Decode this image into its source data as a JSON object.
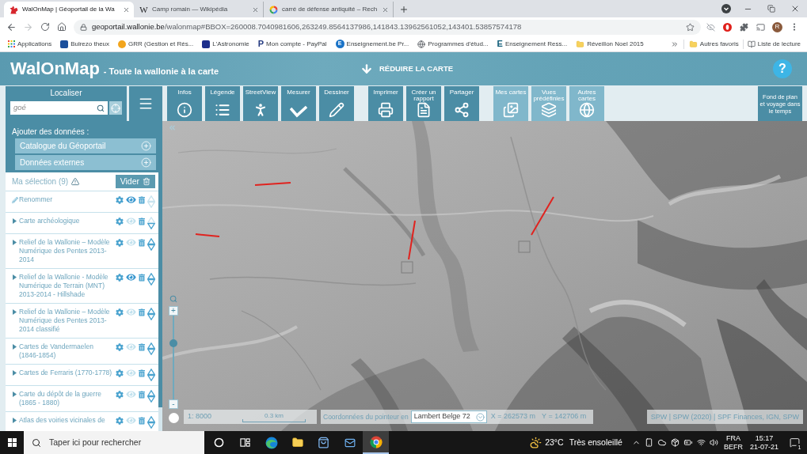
{
  "browser": {
    "tabs": [
      {
        "title": "WalOnMap | Géoportail de la Wa",
        "kind": "rooster",
        "selected": true
      },
      {
        "title": "Camp romain — Wikipédia",
        "kind": "letter",
        "icon_text": "W",
        "selected": false
      },
      {
        "title": "carré de défense antiquité – Rech",
        "kind": "ring",
        "selected": false
      }
    ],
    "address": {
      "host": "geoportail.wallonie.be",
      "path": "/walonmap#BBOX=260008.7040981606,263249.8564137986,141843.13962561052,143401.53857574178",
      "can_go_forward": false
    },
    "profile_initial": "R",
    "bookmarks": [
      {
        "label": "Applications",
        "kind": "apps"
      },
      {
        "label": "Bulrezo theux",
        "kind": "tile",
        "color": "#1b4f9c"
      },
      {
        "label": "GRR (Gestion et Rés...",
        "kind": "disc",
        "color": "#f2a51d"
      },
      {
        "label": "L'Astronomie",
        "kind": "tile",
        "color": "#1d2f8c"
      },
      {
        "label": "Mon compte - PayPal",
        "kind": "letter",
        "icon_text": "P",
        "color": "#253b80"
      },
      {
        "label": "Enseignement.be Pr...",
        "kind": "disc",
        "icon_text": "E",
        "color": "#1a73c7"
      },
      {
        "label": "Programmes d'étud...",
        "kind": "globe"
      },
      {
        "label": "Enseignement Ress...",
        "kind": "letter",
        "icon_text": "E",
        "color": "#0e5b78"
      },
      {
        "label": "Réveillon Noel 2015",
        "kind": "folder"
      }
    ],
    "other_bookmarks": "Autres favoris",
    "reading_list": "Liste de lecture"
  },
  "app_header": {
    "title": "WalOnMap",
    "subtitle": "- Toute la wallonie à la carte",
    "collapse_label": "RÉDUIRE LA CARTE",
    "help": "?"
  },
  "toolbar": {
    "locate": {
      "label": "Localiser",
      "value": "goé"
    },
    "groups": [
      {
        "kind": "dark",
        "tools": [
          {
            "label": "Infos",
            "kind": "info"
          },
          {
            "label": "Légende",
            "kind": "list"
          },
          {
            "label": "StreetView",
            "kind": "person"
          },
          {
            "label": "Mesurer",
            "kind": "angle"
          },
          {
            "label": "Dessiner",
            "kind": "pencil"
          }
        ]
      },
      {
        "kind": "dark",
        "tools": [
          {
            "label": "Imprimer",
            "kind": "printer"
          },
          {
            "label": "Créer un rapport",
            "kind": "document"
          },
          {
            "label": "Partager",
            "kind": "share"
          }
        ]
      },
      {
        "kind": "light",
        "tools": [
          {
            "label": "Mes cartes",
            "kind": "pictures"
          },
          {
            "label": "Vues prédéfinies",
            "kind": "layers"
          },
          {
            "label": "Autres cartes",
            "kind": "globe"
          }
        ]
      }
    ],
    "basemap": "Fond de plan et voyage dans le temps"
  },
  "panel": {
    "add_heading": "Ajouter des données :",
    "sources": [
      "Catalogue du Géoportail",
      "Données externes"
    ],
    "selection_label": "Ma sélection (9)",
    "clear_button": "Vider",
    "layers": [
      {
        "kind": "rename",
        "name": "Renommer",
        "visible": true,
        "up": false,
        "down": false
      },
      {
        "kind": "layer",
        "name": "Carte archéologique",
        "visible": false,
        "up": false,
        "down": true
      },
      {
        "kind": "layer",
        "name": "Relief de la Wallonie – Modèle Numérique des Pentes 2013-2014",
        "visible": false,
        "up": true,
        "down": true
      },
      {
        "kind": "layer",
        "name": "Relief de la Wallonie - Modèle Numérique de Terrain (MNT) 2013-2014 - Hillshade",
        "visible": true,
        "up": true,
        "down": true
      },
      {
        "kind": "layer",
        "name": "Relief de la Wallonie – Modèle Numérique des Pentes 2013-2014 classifié",
        "visible": false,
        "up": true,
        "down": true
      },
      {
        "kind": "layer",
        "name": "Cartes de Vandermaelen (1846-1854)",
        "visible": false,
        "up": true,
        "down": true
      },
      {
        "kind": "layer",
        "name": "Cartes de Ferraris (1770-1778)",
        "visible": false,
        "up": true,
        "down": true
      },
      {
        "kind": "layer",
        "name": "Carte du dépôt de la guerre (1865 - 1880)",
        "visible": false,
        "up": true,
        "down": true
      },
      {
        "kind": "layer",
        "name": "Atlas des voiries vicinales de",
        "visible": false,
        "up": true,
        "down": true
      }
    ]
  },
  "map": {
    "zoom": {
      "plus": "+",
      "minus": "-",
      "level": 0.69
    },
    "scale": {
      "ratio": "1: 8000",
      "bar": "0.3 km"
    },
    "pointer": {
      "label": "Coordonnées du pointeur en",
      "projection": "Lambert Belge 72",
      "x": "X = 262573 m",
      "y": "Y = 142706 m"
    },
    "attribution": "SPW | SPW (2020) | SPF Finances, IGN, SPW"
  },
  "taskbar": {
    "search_placeholder": "Taper ici pour rechercher",
    "apps": [
      {
        "kind": "circle",
        "selected": false
      },
      {
        "kind": "taskview",
        "selected": false
      },
      {
        "kind": "swirl",
        "selected": false
      },
      {
        "kind": "folder",
        "selected": false
      },
      {
        "kind": "bag",
        "selected": false
      },
      {
        "kind": "mail",
        "selected": false
      },
      {
        "kind": "ring",
        "selected": true
      }
    ],
    "temperature": "23°C",
    "condition": "Très ensoleillé",
    "language": "FRA",
    "layout": "BEFR",
    "time": "15:17",
    "date": "21-07-21",
    "notifications": "1"
  }
}
